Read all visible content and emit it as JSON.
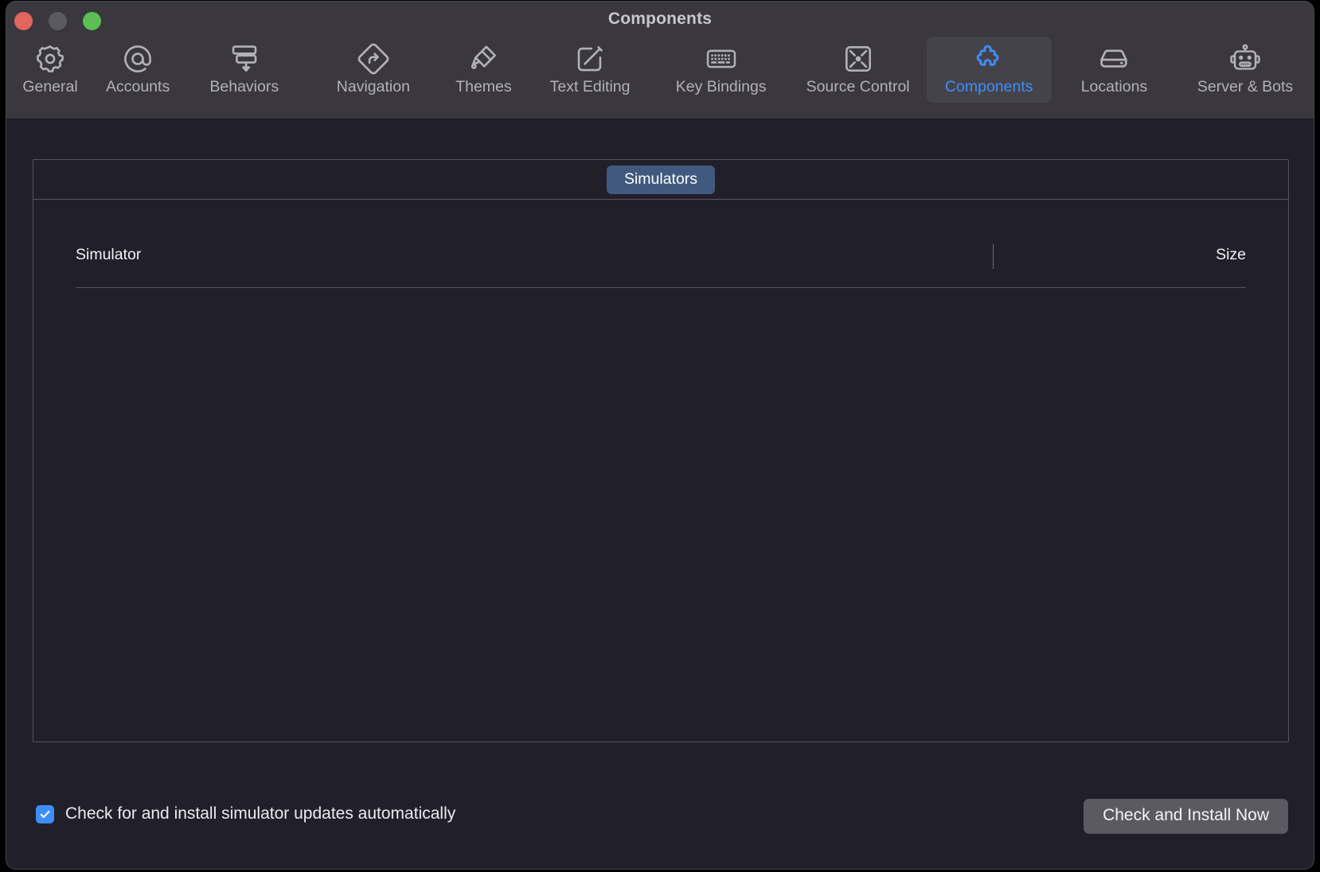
{
  "window": {
    "title": "Components",
    "traffic_lights": [
      {
        "name": "close",
        "color": "#E3655B"
      },
      {
        "name": "minimize",
        "color": "#5C5A61"
      },
      {
        "name": "zoom",
        "color": "#5BBF54"
      }
    ]
  },
  "toolbar": {
    "selected": "Components",
    "accent_color": "#3E8EFA",
    "items": [
      {
        "label": "General",
        "icon": "gear-icon"
      },
      {
        "label": "Accounts",
        "icon": "at-sign-icon"
      },
      {
        "label": "Behaviors",
        "icon": "behaviors-stack-icon"
      },
      {
        "label": "Navigation",
        "icon": "navigation-diamond-arrow-icon"
      },
      {
        "label": "Themes",
        "icon": "paintbrush-icon"
      },
      {
        "label": "Text Editing",
        "icon": "pencil-square-icon"
      },
      {
        "label": "Key Bindings",
        "icon": "keyboard-icon"
      },
      {
        "label": "Source Control",
        "icon": "source-control-node-icon"
      },
      {
        "label": "Components",
        "icon": "puzzle-piece-icon"
      },
      {
        "label": "Locations",
        "icon": "hard-drive-icon"
      },
      {
        "label": "Server & Bots",
        "icon": "robot-icon"
      }
    ]
  },
  "panel": {
    "segmented_control": {
      "options": [
        "Simulators"
      ],
      "selected": "Simulators"
    },
    "table": {
      "columns": [
        "Simulator",
        "Size"
      ],
      "rows": []
    }
  },
  "footer": {
    "checkbox": {
      "label": "Check for and install simulator updates automatically",
      "checked": true,
      "color": "#3E8EFA"
    },
    "button": {
      "label": "Check and Install Now"
    }
  }
}
